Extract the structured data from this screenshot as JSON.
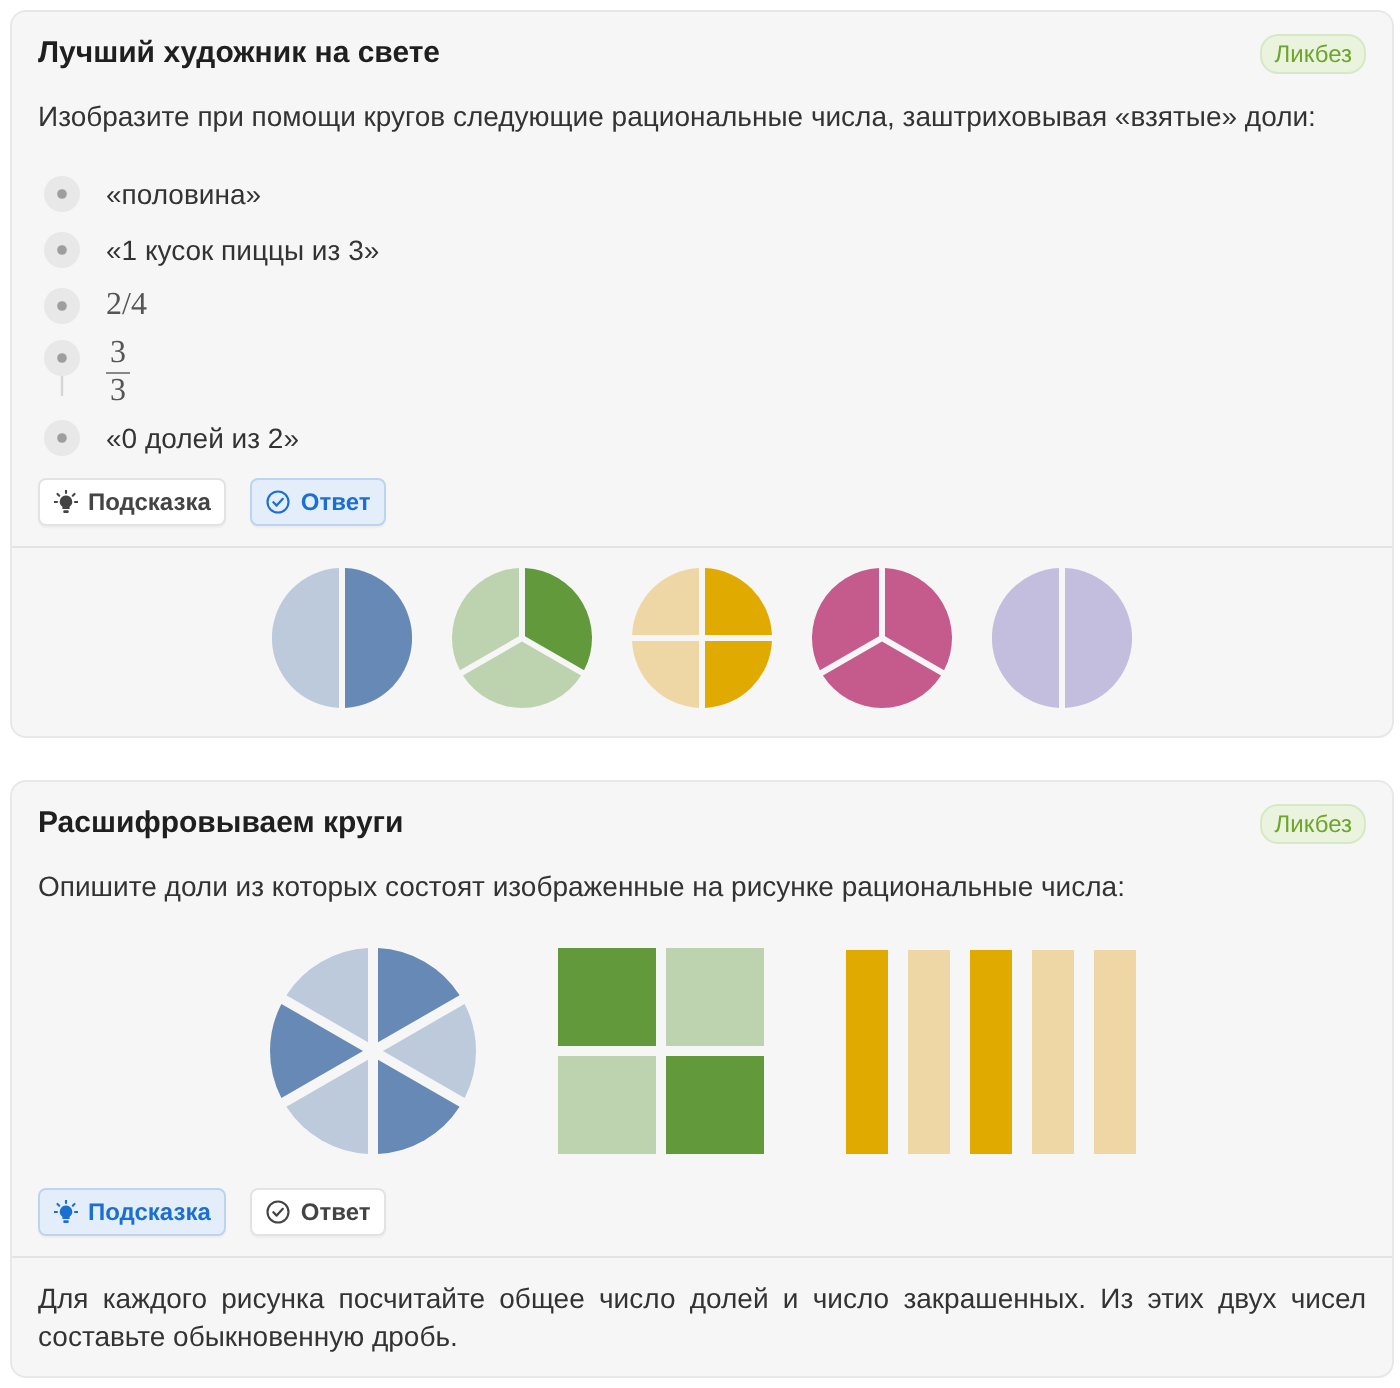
{
  "tasks": [
    {
      "title": "Лучший художник на свете",
      "badge": "Ликбез",
      "text": "Изобразите при помощи кругов следующие рациональные числа, заштриховывая «взятые» доли:",
      "items": [
        {
          "kind": "text",
          "text": "«половина»"
        },
        {
          "kind": "text",
          "text": "«1 кусок пиццы из 3»"
        },
        {
          "kind": "math",
          "text": "2/4"
        },
        {
          "kind": "fraction",
          "numerator": "3",
          "denominator": "3"
        },
        {
          "kind": "text",
          "text": "«0 долей из 2»"
        }
      ],
      "buttons": [
        {
          "kind": "hint",
          "label": "Подсказка",
          "selected": false
        },
        {
          "kind": "answer",
          "label": "Ответ",
          "selected": true
        }
      ],
      "revealed": {
        "kind": "figures",
        "figures": [
          {
            "kind": "circle",
            "parts": [
              {
                "color": "#6689b5"
              },
              {
                "color": "#bccadc"
              }
            ]
          },
          {
            "kind": "circle",
            "parts": [
              {
                "color": "#629a3b"
              },
              {
                "color": "#bdd3b0"
              },
              {
                "color": "#bdd3b0"
              }
            ]
          },
          {
            "kind": "circle",
            "parts": [
              {
                "color": "#e0aa00"
              },
              {
                "color": "#e0aa00"
              },
              {
                "color": "#efd7a5"
              },
              {
                "color": "#efd7a5"
              }
            ]
          },
          {
            "kind": "circle",
            "parts": [
              {
                "color": "#c55b8c"
              },
              {
                "color": "#c55b8c"
              },
              {
                "color": "#c55b8c"
              }
            ]
          },
          {
            "kind": "circle",
            "parts": [
              {
                "color": "#c3bedd"
              },
              {
                "color": "#c3bedd"
              }
            ]
          }
        ]
      }
    },
    {
      "title": "Расшифровываем круги",
      "badge": "Ликбез",
      "text": "Опишите доли из которых состоят изображенные на рисунке рациональные числа:",
      "figures": [
        {
          "kind": "circle",
          "parts": [
            {
              "color": "#6689b5"
            },
            {
              "color": "#bccadc"
            },
            {
              "color": "#6689b5"
            },
            {
              "color": "#bccadc"
            },
            {
              "color": "#6689b5"
            },
            {
              "color": "#bccadc"
            }
          ]
        },
        {
          "kind": "grid",
          "parts": [
            {
              "color": "#629a3b"
            },
            {
              "color": "#bdd3b0"
            },
            {
              "color": "#bdd3b0"
            },
            {
              "color": "#629a3b"
            }
          ]
        },
        {
          "kind": "strips",
          "parts": [
            {
              "color": "#e0aa00"
            },
            {
              "color": "#efd7a5"
            },
            {
              "color": "#e0aa00"
            },
            {
              "color": "#efd7a5"
            },
            {
              "color": "#efd7a5"
            }
          ]
        }
      ],
      "buttons": [
        {
          "kind": "hint",
          "label": "Подсказка",
          "selected": true
        },
        {
          "kind": "answer",
          "label": "Ответ",
          "selected": false
        }
      ],
      "revealed": {
        "kind": "text",
        "text": "Для каждого рисунка посчитайте общее число долей и число закрашенных. Из этих двух чисел составьте обыкновенную дробь."
      }
    }
  ]
}
